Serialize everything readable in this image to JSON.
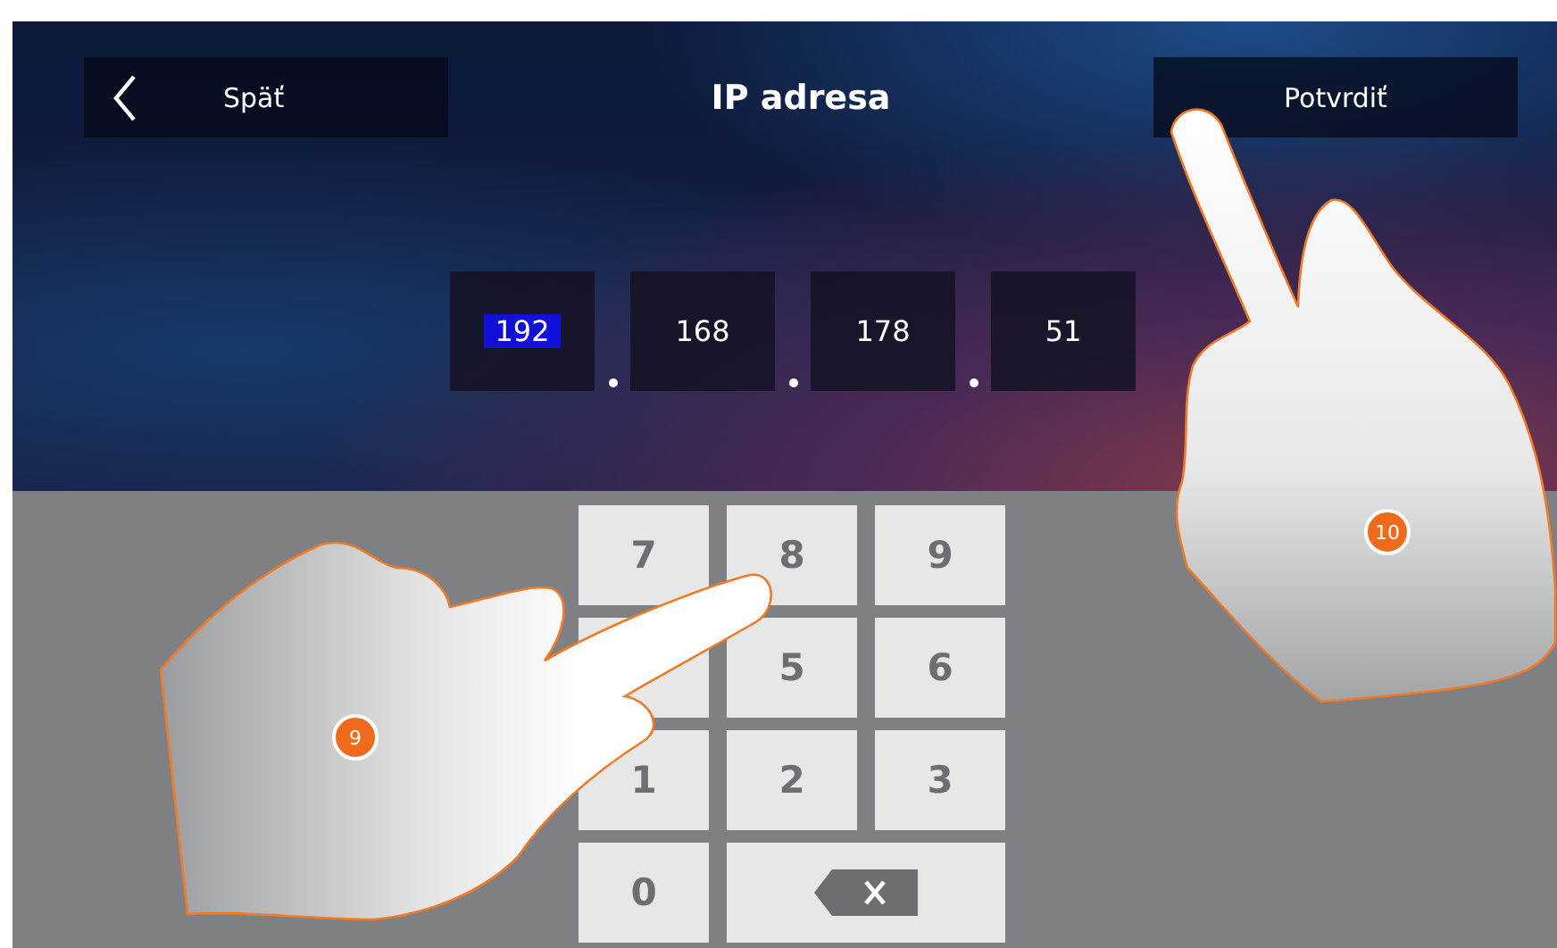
{
  "header": {
    "back_button": {
      "label": "Späť"
    },
    "title": "IP adresa",
    "confirm_button": {
      "label": "Potvrdiť"
    }
  },
  "ip_fields": [
    {
      "value": "192",
      "selected": true
    },
    {
      "value": "168",
      "selected": false
    },
    {
      "value": "178",
      "selected": false
    },
    {
      "value": "51",
      "selected": false
    }
  ],
  "keypad": [
    {
      "kind": "digit",
      "label": "7"
    },
    {
      "kind": "digit",
      "label": "8"
    },
    {
      "kind": "digit",
      "label": "9"
    },
    {
      "kind": "covered"
    },
    {
      "kind": "digit",
      "label": "5"
    },
    {
      "kind": "digit",
      "label": "6"
    },
    {
      "kind": "digit",
      "label": "1"
    },
    {
      "kind": "digit",
      "label": "2"
    },
    {
      "kind": "digit",
      "label": "3"
    },
    {
      "kind": "digit",
      "label": "0"
    },
    {
      "kind": "backspace"
    }
  ],
  "callouts": [
    {
      "label": "9"
    },
    {
      "label": "10"
    }
  ]
}
